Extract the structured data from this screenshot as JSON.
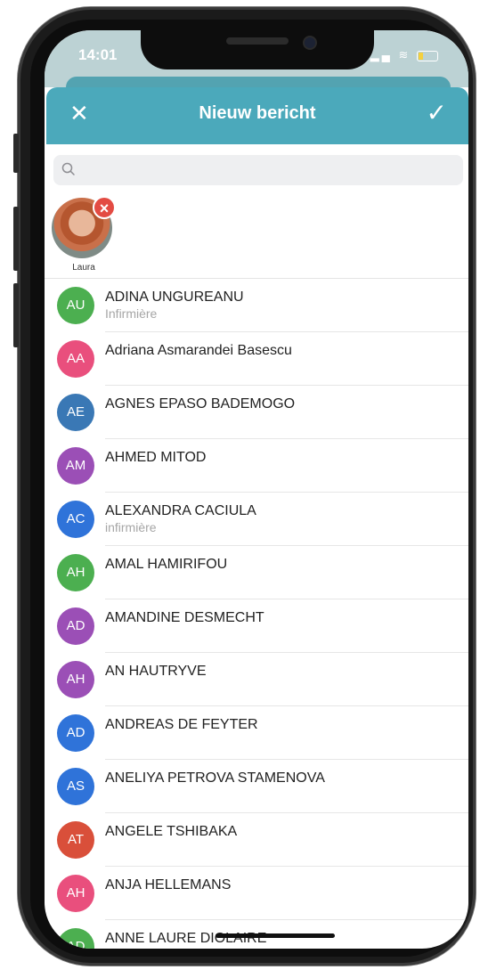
{
  "status": {
    "time": "14:01"
  },
  "header": {
    "title": "Nieuw bericht"
  },
  "search": {
    "placeholder": ""
  },
  "selected_recipients": [
    {
      "label": "Laura"
    }
  ],
  "contacts": [
    {
      "initials": "AU",
      "name": "ADINA UNGUREANU",
      "subtitle": "Infirmière",
      "color": "#4caf50"
    },
    {
      "initials": "AA",
      "name": "Adriana Asmarandei Basescu",
      "subtitle": "",
      "color": "#e94f7d"
    },
    {
      "initials": "AE",
      "name": "AGNES EPASO BADEMOGO",
      "subtitle": "",
      "color": "#3a78b5"
    },
    {
      "initials": "AM",
      "name": "AHMED MITOD",
      "subtitle": "",
      "color": "#9b4fb6"
    },
    {
      "initials": "AC",
      "name": "ALEXANDRA CACIULA",
      "subtitle": "infirmière",
      "color": "#2f73d9"
    },
    {
      "initials": "AH",
      "name": "AMAL HAMIRIFOU",
      "subtitle": "",
      "color": "#4caf50"
    },
    {
      "initials": "AD",
      "name": "AMANDINE DESMECHT",
      "subtitle": "",
      "color": "#9b4fb6"
    },
    {
      "initials": "AH",
      "name": "AN HAUTRYVE",
      "subtitle": "",
      "color": "#9b4fb6"
    },
    {
      "initials": "AD",
      "name": "ANDREAS DE FEYTER",
      "subtitle": "",
      "color": "#2f73d9"
    },
    {
      "initials": "AS",
      "name": "ANELIYA PETROVA STAMENOVA",
      "subtitle": "",
      "color": "#2f73d9"
    },
    {
      "initials": "AT",
      "name": "ANGELE TSHIBAKA",
      "subtitle": "",
      "color": "#d94f3a"
    },
    {
      "initials": "AH",
      "name": "ANJA HELLEMANS",
      "subtitle": "",
      "color": "#e94f7d"
    },
    {
      "initials": "AD",
      "name": "ANNE LAURE DIOLAIRE",
      "subtitle": "",
      "color": "#4caf50"
    }
  ]
}
